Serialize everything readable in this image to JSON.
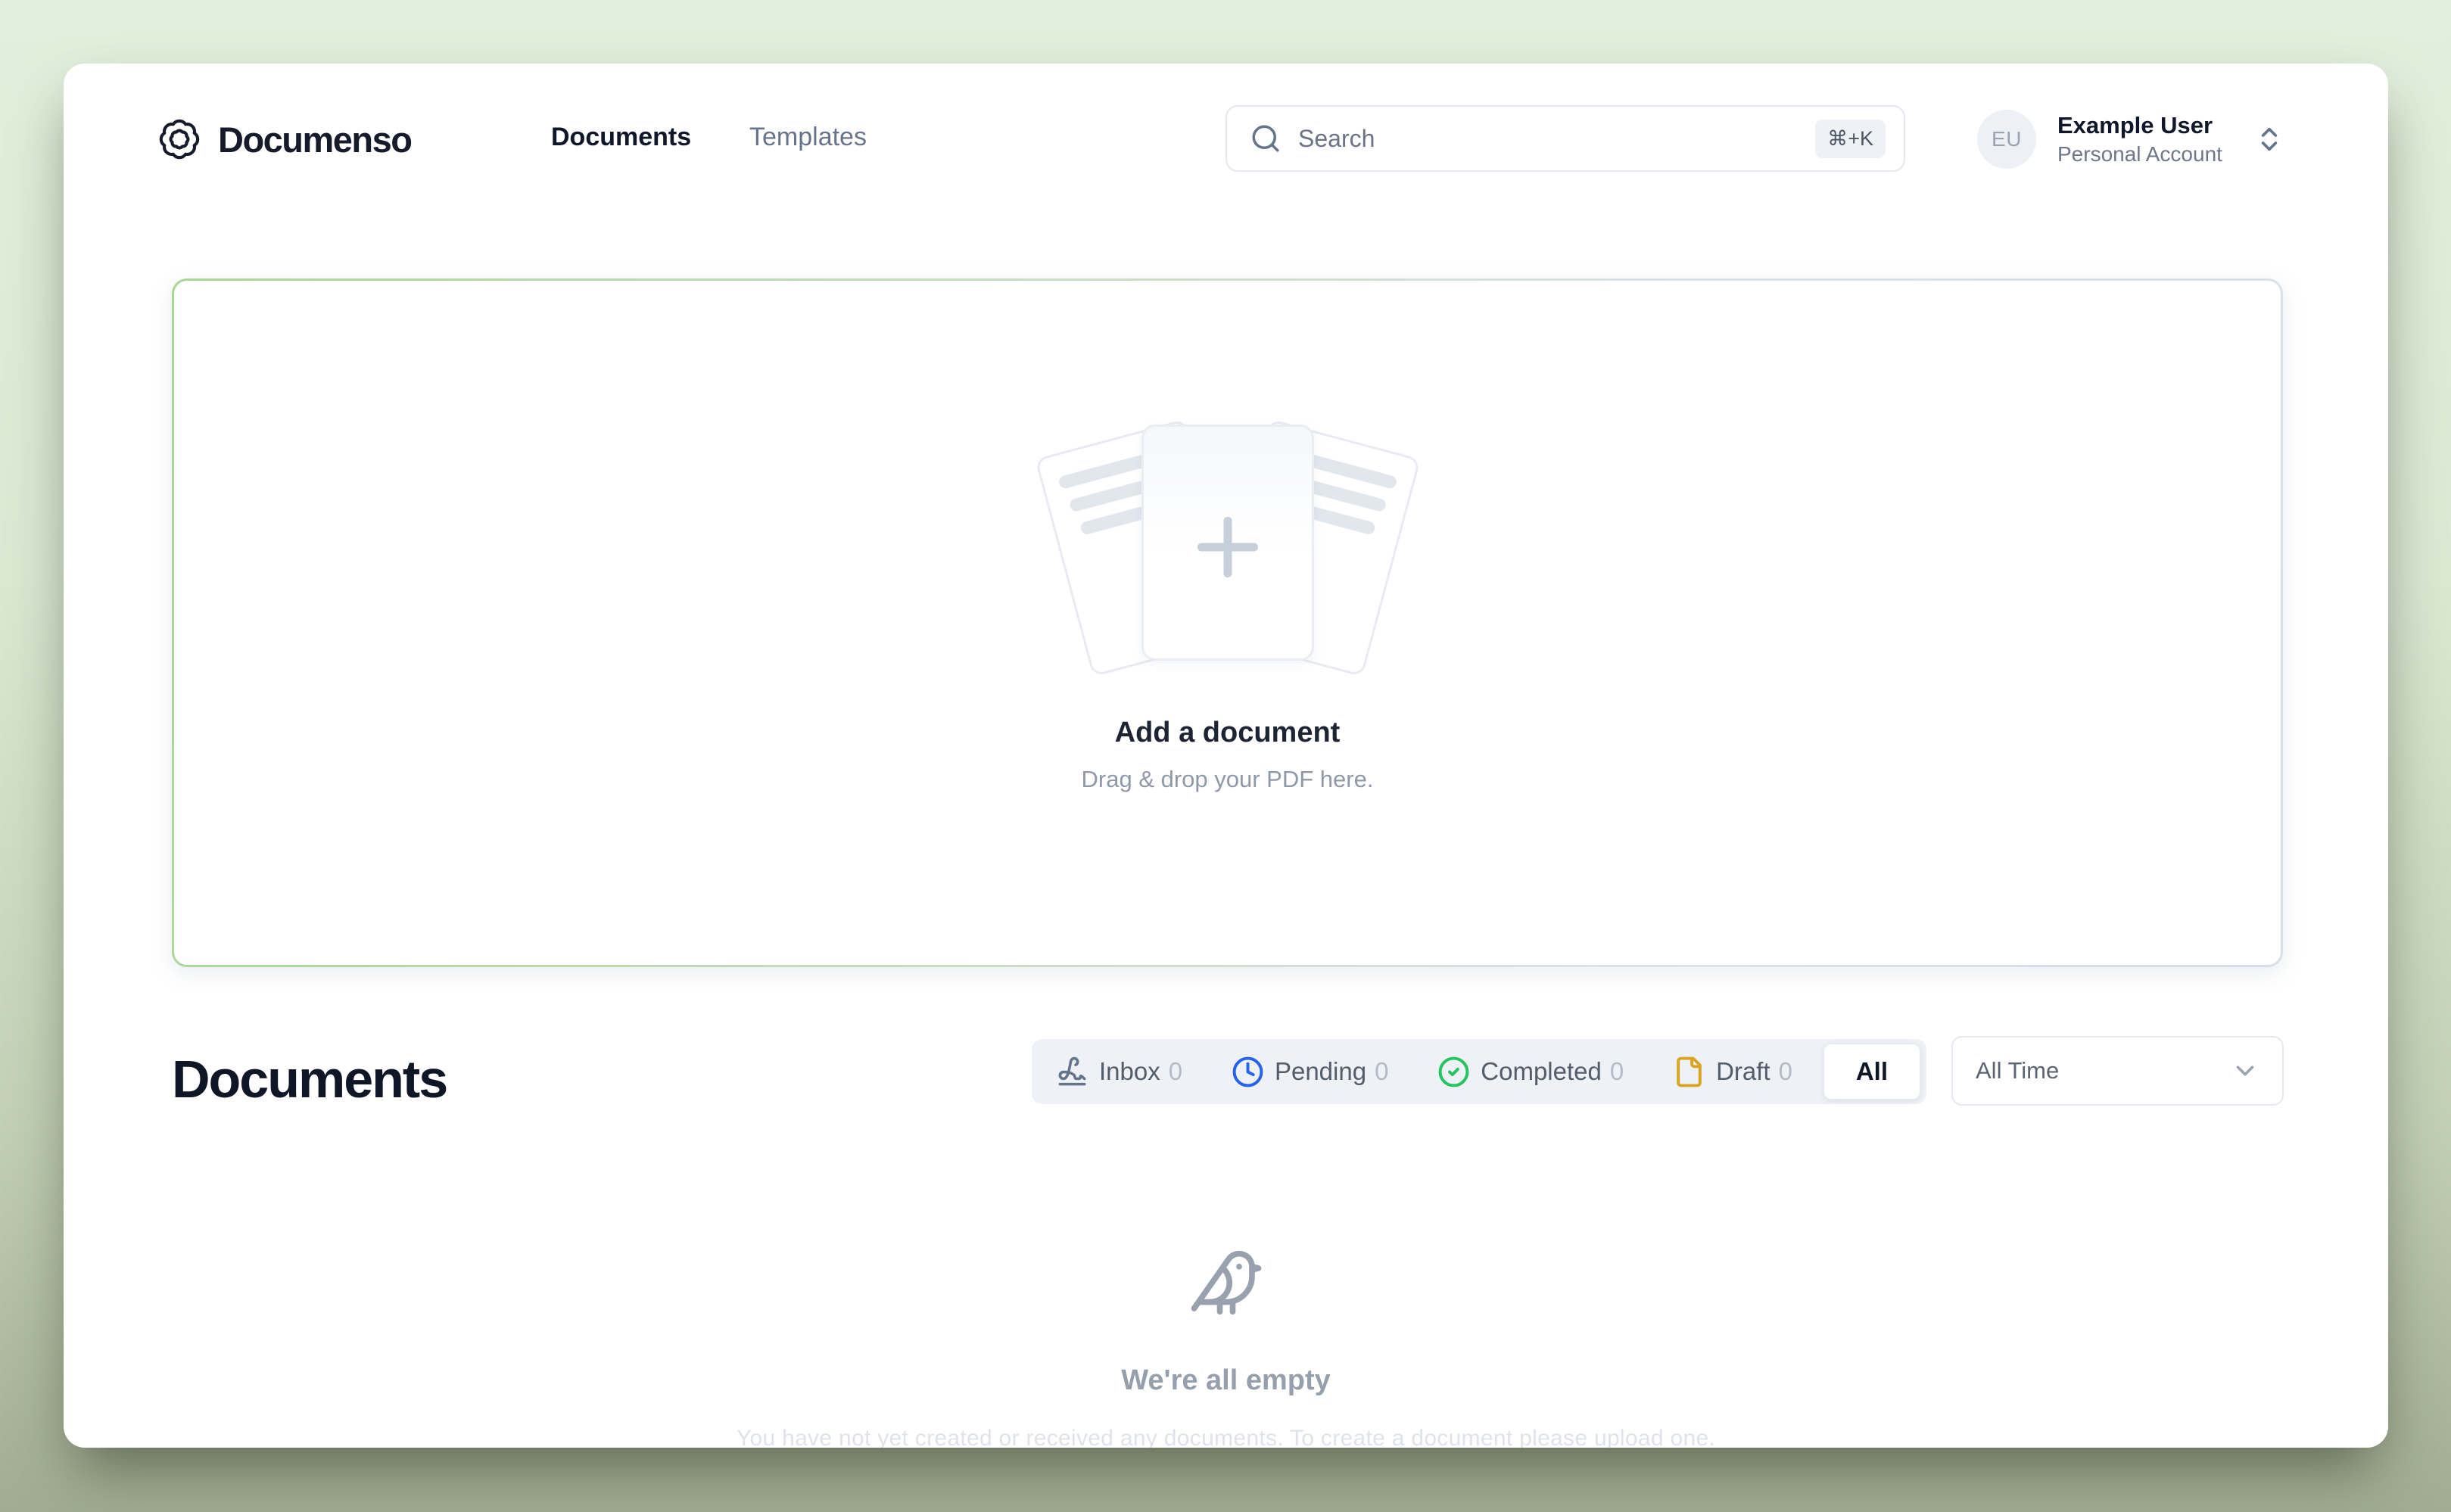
{
  "header": {
    "logo_text": "Documenso",
    "nav": [
      {
        "label": "Documents",
        "active": true
      },
      {
        "label": "Templates",
        "active": false
      }
    ],
    "search": {
      "placeholder": "Search",
      "shortcut": "⌘+K"
    },
    "user": {
      "initials": "EU",
      "name": "Example User",
      "account_type": "Personal Account"
    }
  },
  "dropzone": {
    "title": "Add a document",
    "subtitle": "Drag & drop your PDF here."
  },
  "documents_section": {
    "heading": "Documents",
    "filters": [
      {
        "label": "Inbox",
        "count": "0",
        "icon": "signature-icon",
        "color": "#64748b",
        "active": false
      },
      {
        "label": "Pending",
        "count": "0",
        "icon": "clock-icon",
        "color": "#2563eb",
        "active": false
      },
      {
        "label": "Completed",
        "count": "0",
        "icon": "circle-check-icon",
        "color": "#22c55e",
        "active": false
      },
      {
        "label": "Draft",
        "count": "0",
        "icon": "file-icon",
        "color": "#d9a521",
        "active": false
      },
      {
        "label": "All",
        "count": "",
        "icon": "",
        "color": "",
        "active": true
      }
    ],
    "period_filter": {
      "value": "All Time"
    }
  },
  "empty_state": {
    "title": "We're all empty",
    "description": "You have not yet created or received any documents. To create a document please upload one."
  },
  "colors": {
    "background_top": "#e2efdc",
    "background_bottom": "#a1ad92",
    "card": "#ffffff",
    "accent_green_border": "#a6d795",
    "text_dark": "#0f1626",
    "text_muted": "#6b7486"
  }
}
